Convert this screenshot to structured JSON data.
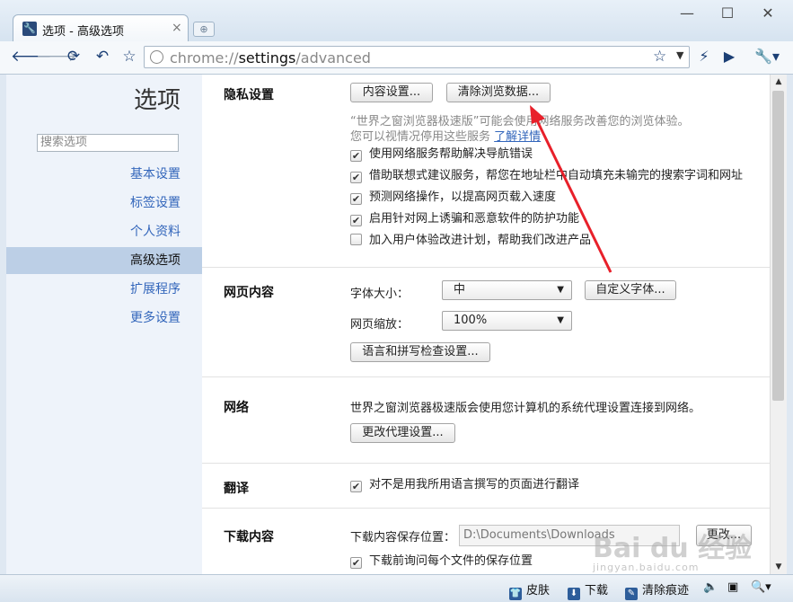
{
  "tab": {
    "title": "选项 - 高级选项",
    "close": "×"
  },
  "window": {
    "minimize": "—",
    "maximize": "☐",
    "close": "✕"
  },
  "toolbar": {
    "url_scheme": "chrome://",
    "url_host": "settings",
    "url_path": "/advanced"
  },
  "sidebar": {
    "title": "选项",
    "search_placeholder": "搜索选项",
    "items": [
      {
        "label": "基本设置",
        "active": false
      },
      {
        "label": "标签设置",
        "active": false
      },
      {
        "label": "个人资料",
        "active": false
      },
      {
        "label": "高级选项",
        "active": true
      },
      {
        "label": "扩展程序",
        "active": false
      },
      {
        "label": "更多设置",
        "active": false
      }
    ]
  },
  "privacy": {
    "title": "隐私设置",
    "content_settings_btn": "内容设置...",
    "clear_data_btn": "清除浏览数据...",
    "desc_line1": "“世界之窗浏览器极速版”可能会使用网络服务改善您的浏览体验。",
    "desc_line2": "您可以视情况停用这些服务",
    "learn_more": "了解详情",
    "options": [
      {
        "label": "使用网络服务帮助解决导航错误",
        "checked": true
      },
      {
        "label": "借助联想式建议服务，帮您在地址栏中自动填充未输完的搜索字词和网址",
        "checked": true
      },
      {
        "label": "预测网络操作，以提高网页载入速度",
        "checked": true
      },
      {
        "label": "启用针对网上诱骗和恶意软件的防护功能",
        "checked": true
      },
      {
        "label": "加入用户体验改进计划，帮助我们改进产品",
        "checked": false
      }
    ]
  },
  "webcontent": {
    "title": "网页内容",
    "font_size_label": "字体大小：",
    "font_size_value": "中",
    "custom_fonts_btn": "自定义字体...",
    "zoom_label": "网页缩放：",
    "zoom_value": "100%",
    "lang_btn": "语言和拼写检查设置..."
  },
  "network": {
    "title": "网络",
    "desc": "世界之窗浏览器极速版会使用您计算机的系统代理设置连接到网络。",
    "proxy_btn": "更改代理设置..."
  },
  "translate": {
    "title": "翻译",
    "option": "对不是用我所用语言撰写的页面进行翻译",
    "checked": true
  },
  "downloads": {
    "title": "下载内容",
    "location_label": "下载内容保存位置：",
    "location_value": "D:\\Documents\\Downloads",
    "change_btn": "更改...",
    "ask_option": "下载前询问每个文件的保存位置",
    "ask_checked": true
  },
  "statusbar": {
    "skin": "皮肤",
    "download": "下载",
    "clear_traces": "清除痕迹"
  },
  "watermark": {
    "text": "Bai du 经验",
    "sub": "jingyan.baidu.com"
  },
  "colors": {
    "accent": "#3366bb",
    "arrow": "#e8202a",
    "active_item": "#bccfe6"
  }
}
